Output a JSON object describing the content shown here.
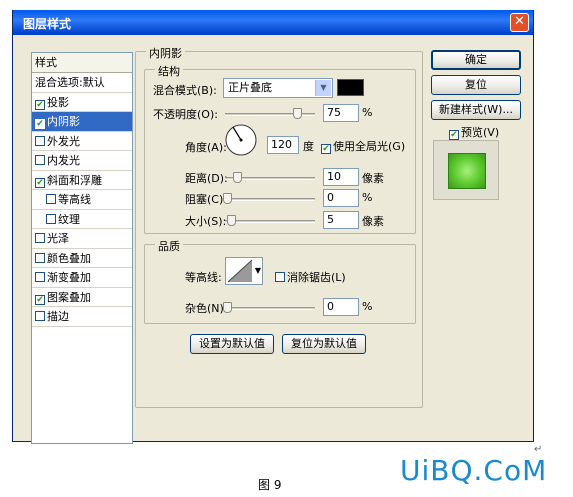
{
  "window": {
    "title": "图层样式",
    "close_glyph": "✕"
  },
  "left_panel": {
    "header": "样式",
    "items": [
      {
        "label": "混合选项:默认",
        "has_checkbox": false,
        "checked": false,
        "indent": false,
        "selected": false
      },
      {
        "label": "投影",
        "has_checkbox": true,
        "checked": true,
        "indent": false,
        "selected": false
      },
      {
        "label": "内阴影",
        "has_checkbox": true,
        "checked": true,
        "indent": false,
        "selected": true
      },
      {
        "label": "外发光",
        "has_checkbox": true,
        "checked": false,
        "indent": false,
        "selected": false
      },
      {
        "label": "内发光",
        "has_checkbox": true,
        "checked": false,
        "indent": false,
        "selected": false
      },
      {
        "label": "斜面和浮雕",
        "has_checkbox": true,
        "checked": true,
        "indent": false,
        "selected": false
      },
      {
        "label": "等高线",
        "has_checkbox": true,
        "checked": false,
        "indent": true,
        "selected": false
      },
      {
        "label": "纹理",
        "has_checkbox": true,
        "checked": false,
        "indent": true,
        "selected": false
      },
      {
        "label": "光泽",
        "has_checkbox": true,
        "checked": false,
        "indent": false,
        "selected": false
      },
      {
        "label": "颜色叠加",
        "has_checkbox": true,
        "checked": false,
        "indent": false,
        "selected": false
      },
      {
        "label": "渐变叠加",
        "has_checkbox": true,
        "checked": false,
        "indent": false,
        "selected": false
      },
      {
        "label": "图案叠加",
        "has_checkbox": true,
        "checked": true,
        "indent": false,
        "selected": false
      },
      {
        "label": "描边",
        "has_checkbox": true,
        "checked": false,
        "indent": false,
        "selected": false
      }
    ]
  },
  "inner_shadow": {
    "group_title": "内阴影",
    "structure": {
      "title": "结构",
      "blend_mode_label": "混合模式(B):",
      "blend_mode_value": "正片叠底",
      "blend_color": "#000000",
      "opacity_label": "不透明度(O):",
      "opacity_value": "75",
      "opacity_unit": "%",
      "angle_label": "角度(A):",
      "angle_value": "120",
      "angle_unit": "度",
      "global_light_label": "使用全局光(G)",
      "global_light_checked": true,
      "distance_label": "距离(D):",
      "distance_value": "10",
      "distance_unit": "像素",
      "choke_label": "阻塞(C):",
      "choke_value": "0",
      "choke_unit": "%",
      "size_label": "大小(S):",
      "size_value": "5",
      "size_unit": "像素"
    },
    "quality": {
      "title": "品质",
      "contour_label": "等高线:",
      "anti_alias_label": "消除锯齿(L)",
      "anti_alias_checked": false,
      "noise_label": "杂色(N):",
      "noise_value": "0",
      "noise_unit": "%"
    },
    "set_default_button": "设置为默认值",
    "reset_default_button": "复位为默认值"
  },
  "right_buttons": {
    "ok": "确定",
    "reset": "复位",
    "new_style": "新建样式(W)...",
    "preview_label": "预览(V)",
    "preview_checked": true
  },
  "caption": "图 9",
  "watermark": "UiBQ.CoM"
}
